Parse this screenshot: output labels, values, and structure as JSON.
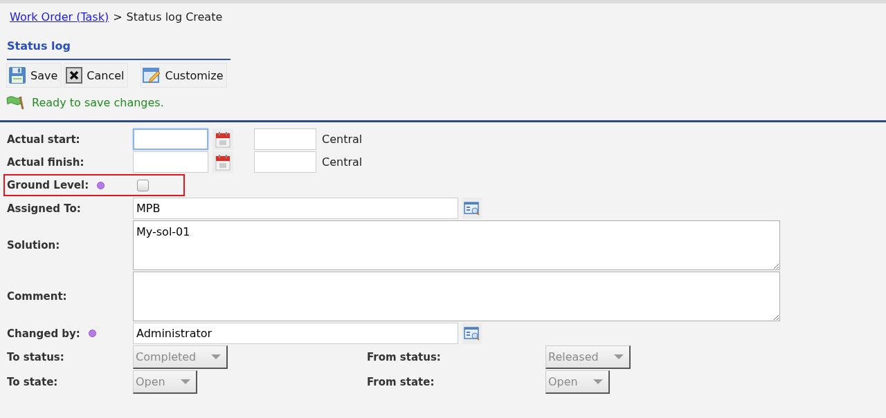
{
  "breadcrumb": {
    "link": "Work Order (Task)",
    "separator": ">",
    "current": "Status log Create"
  },
  "section_title": "Status log",
  "toolbar": [
    {
      "kind": "save",
      "label": "Save"
    },
    {
      "kind": "cancel",
      "label": "Cancel"
    },
    {
      "kind": "customize",
      "label": "Customize"
    }
  ],
  "message": "Ready to save changes.",
  "fields": [
    {
      "kind": "datetime",
      "label": "Actual start:",
      "focused": true,
      "timezone": "Central"
    },
    {
      "kind": "datetime",
      "label": "Actual finish:",
      "focused": false,
      "timezone": "Central"
    },
    {
      "kind": "checkbox",
      "label": "Ground Level:",
      "required": true,
      "checked": false,
      "highlighted": true
    },
    {
      "kind": "lookup",
      "label": "Assigned To:",
      "required": false,
      "value": "MPB"
    },
    {
      "kind": "textarea",
      "label": "Solution:",
      "value": "My-sol-01"
    },
    {
      "kind": "textarea",
      "label": "Comment:"
    },
    {
      "kind": "lookup",
      "label": "Changed by:",
      "required": true,
      "value": "Administrator"
    }
  ],
  "select_rows": [
    {
      "left": {
        "label": "To status:",
        "value": "Completed",
        "disabled": true
      },
      "right": {
        "label": "From status:",
        "value": "Released",
        "disabled": true
      }
    },
    {
      "left": {
        "label": "To state:",
        "value": "Open",
        "disabled": true
      },
      "right": {
        "label": "From state:",
        "value": "Open",
        "disabled": true
      }
    }
  ]
}
